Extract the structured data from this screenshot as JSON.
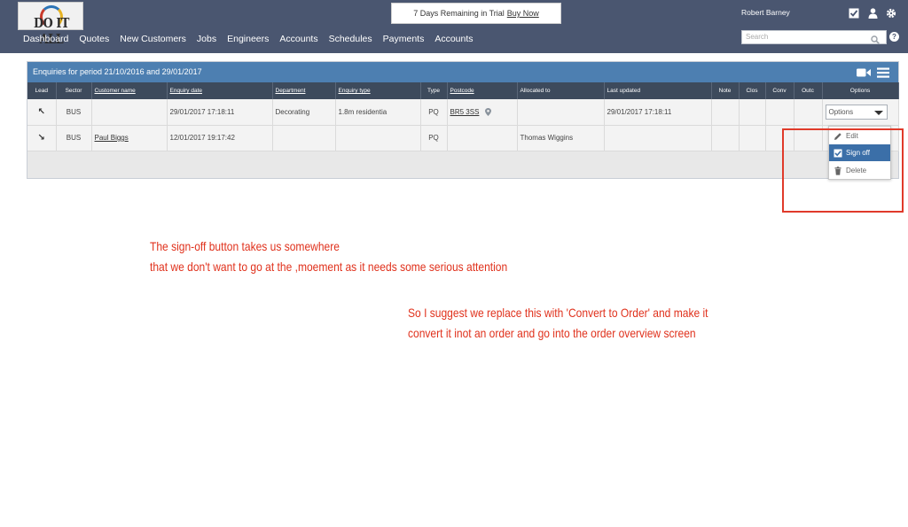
{
  "header": {
    "logo_text": "DO IT ALL",
    "trial_text": "7 Days Remaining in Trial",
    "trial_link": "Buy Now",
    "username": "Robert Barney",
    "search_placeholder": "Search",
    "help_label": "?",
    "nav": [
      "Dashboard",
      "Quotes",
      "New Customers",
      "Jobs",
      "Engineers",
      "Accounts",
      "Schedules",
      "Payments",
      "Accounts"
    ]
  },
  "panel": {
    "title": "Enquiries for period 21/10/2016 and 29/01/2017",
    "columns": [
      "Lead",
      "Sector",
      "Customer name",
      "Enquiry date",
      "Department",
      "Enquiry type",
      "Type",
      "Postcode",
      "Allocated to",
      "Last updated",
      "Note",
      "Clos",
      "Conv",
      "Outc",
      "Options"
    ],
    "rows": [
      {
        "lead": "↖",
        "sector": "BUS",
        "customer": "",
        "date": "29/01/2017 17:18:11",
        "department": "Decorating",
        "enquiry_type": "1.8m residentia",
        "type": "PQ",
        "postcode": "BR5 3SS",
        "allocated": "",
        "updated": "29/01/2017 17:18:11",
        "options": "Options"
      },
      {
        "lead": "↘",
        "sector": "BUS",
        "customer": "Paul Biggs",
        "date": "12/01/2017 19:17:42",
        "department": "",
        "enquiry_type": "",
        "type": "PQ",
        "postcode": "",
        "allocated": "Thomas Wiggins",
        "updated": "",
        "options": ""
      }
    ]
  },
  "dropdown": {
    "items": [
      "Edit",
      "Sign off",
      "Delete"
    ],
    "selected": "Sign off"
  },
  "annotations": {
    "note1_line1": "The sign-off button takes us somewhere",
    "note1_line2": "that we don't want to go at the ,moement as it needs some serious attention",
    "note2_line1": "So I suggest we replace this with 'Convert to Order' and make it",
    "note2_line2": "convert it inot an order and go into the order overview screen"
  },
  "colors": {
    "header_bg": "#4a5670",
    "panel_head_bg": "#4d7fb1",
    "table_head_bg": "#3d4a5c",
    "selected_item": "#3b6fa8",
    "annotation_red": "#e0311c"
  }
}
